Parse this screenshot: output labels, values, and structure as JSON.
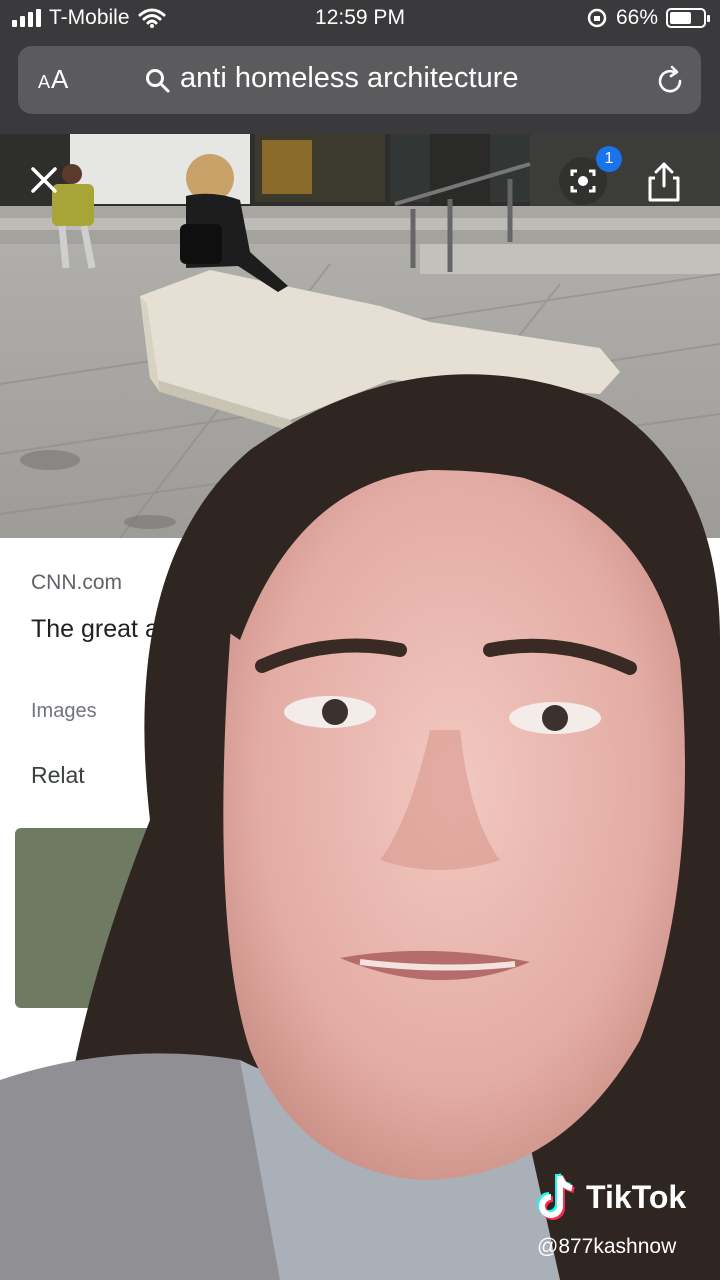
{
  "status_bar": {
    "carrier": "T-Mobile",
    "time": "12:59 PM",
    "battery_percent": "66%",
    "battery_level": 0.66
  },
  "address_bar": {
    "text_size_label": "AA",
    "query": "anti homeless architecture",
    "icons": [
      "search-icon",
      "reload-icon"
    ]
  },
  "image_viewer": {
    "lens_badge_count": "1",
    "icons": [
      "close-icon",
      "lens-icon",
      "share-icon"
    ]
  },
  "result": {
    "source": "CNN.com",
    "title": "The great architect",
    "images_label": "Images",
    "related_label": "Relat"
  },
  "watermark": {
    "app_name": "TikTok",
    "handle": "@877kashnow"
  },
  "colors": {
    "status_bg": "#3a3a3c",
    "address_pill": "#5b5b5e",
    "lens_badge": "#1a73e8",
    "tiktok_cyan": "#25f4ee",
    "tiktok_red": "#fe2c55"
  }
}
